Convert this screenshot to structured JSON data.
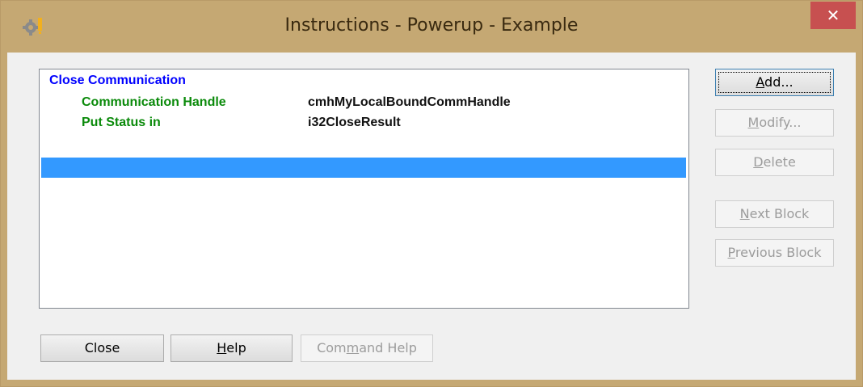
{
  "window": {
    "title": "Instructions - Powerup - Example",
    "close_glyph": "✕",
    "titlebar_color": "#c5a873",
    "close_color": "#c75050"
  },
  "list": {
    "header": "Close Communication",
    "header_color": "#0000ff",
    "label_color": "#0a8a0a",
    "rows": [
      {
        "label": "Communication Handle",
        "value": "cmhMyLocalBoundCommHandle"
      },
      {
        "label": "Put Status in",
        "value": "i32CloseResult"
      }
    ],
    "selection_color": "#3399ff"
  },
  "side_buttons": {
    "add": {
      "pre": "",
      "key": "A",
      "post": "dd...",
      "enabled": true
    },
    "modify": {
      "pre": "",
      "key": "M",
      "post": "odify...",
      "enabled": false
    },
    "delete": {
      "pre": "",
      "key": "D",
      "post": "elete",
      "enabled": false
    },
    "next": {
      "pre": "",
      "key": "N",
      "post": "ext Block",
      "enabled": false
    },
    "prev": {
      "pre": "",
      "key": "P",
      "post": "revious Block",
      "enabled": false
    }
  },
  "bottom_buttons": {
    "close": {
      "pre": "Close",
      "key": "",
      "post": "",
      "enabled": true
    },
    "help": {
      "pre": "",
      "key": "H",
      "post": "elp",
      "enabled": true
    },
    "command_help": {
      "pre": "Com",
      "key": "m",
      "post": "and Help",
      "enabled": false
    }
  }
}
